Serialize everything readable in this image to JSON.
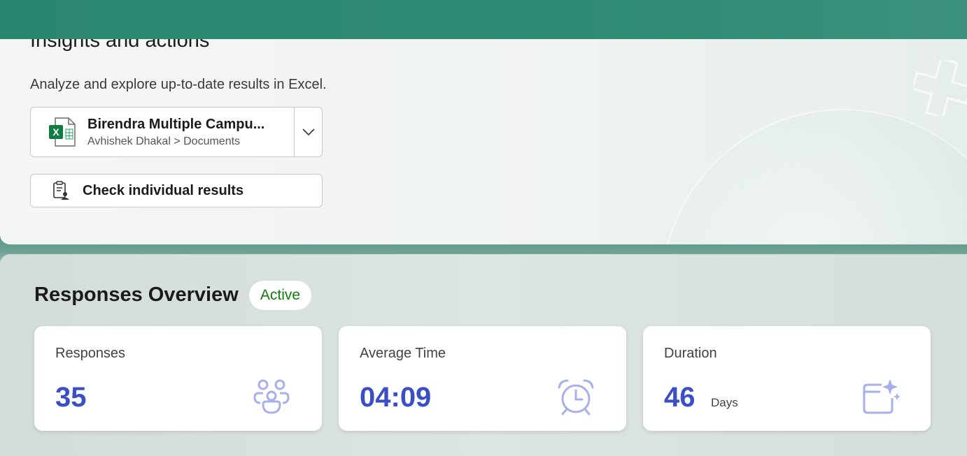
{
  "insights": {
    "title": "Insights and actions",
    "description": "Analyze and explore up-to-date results in Excel.",
    "file": {
      "name": "Birendra Multiple Campu...",
      "path": "Avhishek Dhakal > Documents"
    },
    "check_results_label": "Check individual results"
  },
  "overview": {
    "title": "Responses Overview",
    "status": "Active",
    "stats": [
      {
        "label": "Responses",
        "value": "35",
        "icon": "people-icon"
      },
      {
        "label": "Average Time",
        "value": "04:09",
        "icon": "alarm-clock-icon"
      },
      {
        "label": "Duration",
        "value": "46",
        "unit": "Days",
        "icon": "calendar-sparkle-icon"
      }
    ]
  },
  "colors": {
    "header_green": "#2b8670",
    "accent_blue": "#3b4fc4",
    "active_green": "#107c10",
    "icon_lavender": "#a7b0e8"
  }
}
